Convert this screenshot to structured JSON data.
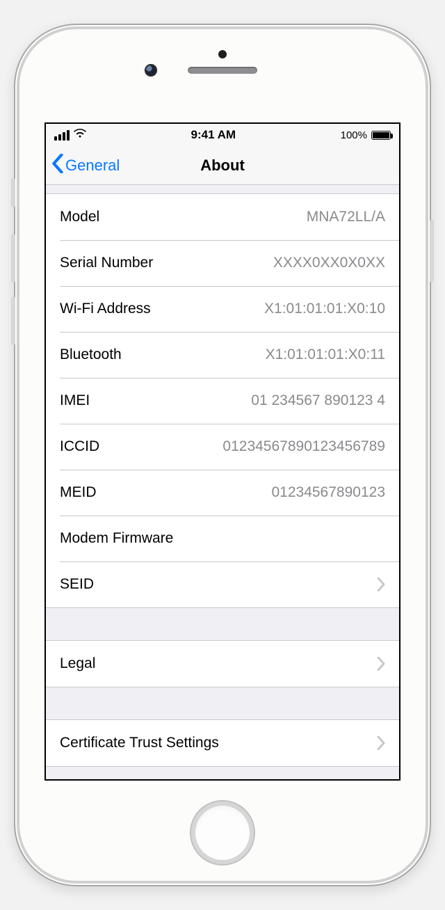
{
  "status": {
    "time": "9:41 AM",
    "battery_pct": "100%"
  },
  "nav": {
    "back_label": "General",
    "title": "About"
  },
  "rows": {
    "model": {
      "label": "Model",
      "value": "MNA72LL/A"
    },
    "serial": {
      "label": "Serial Number",
      "value": "XXXX0XX0X0XX"
    },
    "wifi": {
      "label": "Wi-Fi Address",
      "value": "X1:01:01:01:X0:10"
    },
    "bluetooth": {
      "label": "Bluetooth",
      "value": "X1:01:01:01:X0:11"
    },
    "imei": {
      "label": "IMEI",
      "value": "01 234567 890123 4"
    },
    "iccid": {
      "label": "ICCID",
      "value": "01234567890123456789"
    },
    "meid": {
      "label": "MEID",
      "value": "01234567890123"
    },
    "modem": {
      "label": "Modem Firmware",
      "value": ""
    },
    "seid": {
      "label": "SEID"
    },
    "legal": {
      "label": "Legal"
    },
    "cert": {
      "label": "Certificate Trust Settings"
    }
  }
}
